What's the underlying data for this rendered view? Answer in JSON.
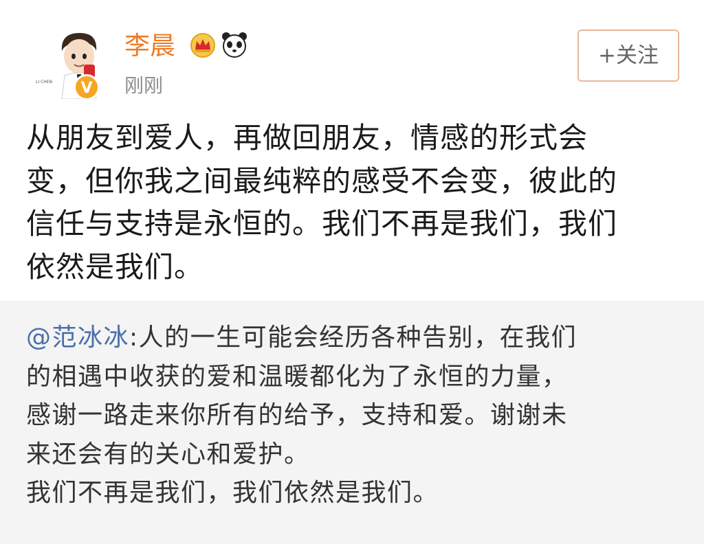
{
  "header": {
    "username": "李晨",
    "time": "刚刚",
    "follow_label": "+关注",
    "avatar_caption": "LI CHEN"
  },
  "icons": {
    "verified": "verified-v-badge",
    "crown": "crown-icon",
    "panda": "panda-icon"
  },
  "post": {
    "lines": [
      "从朋友到爱人，再做回朋友，情感的形式会",
      "变，但你我之间最纯粹的感受不会变，彼此的",
      "信任与支持是永恒的。我们不再是我们，我们",
      "依然是我们。"
    ]
  },
  "repost": {
    "mention": "@范冰冰",
    "line1_rest": ":人的一生可能会经历各种告别，在我们",
    "lines": [
      "的相遇中收获的爱和温暖都化为了永恒的力量，",
      "感谢一路走来你所有的给予，支持和爱。谢谢未",
      "来还会有的关心和爱护。",
      "我们不再是我们，我们依然是我们。"
    ]
  },
  "colors": {
    "username": "#ee7b25",
    "mention": "#4a6fa8",
    "repost_bg": "#f4f4f4",
    "badge": "#f5a623"
  }
}
